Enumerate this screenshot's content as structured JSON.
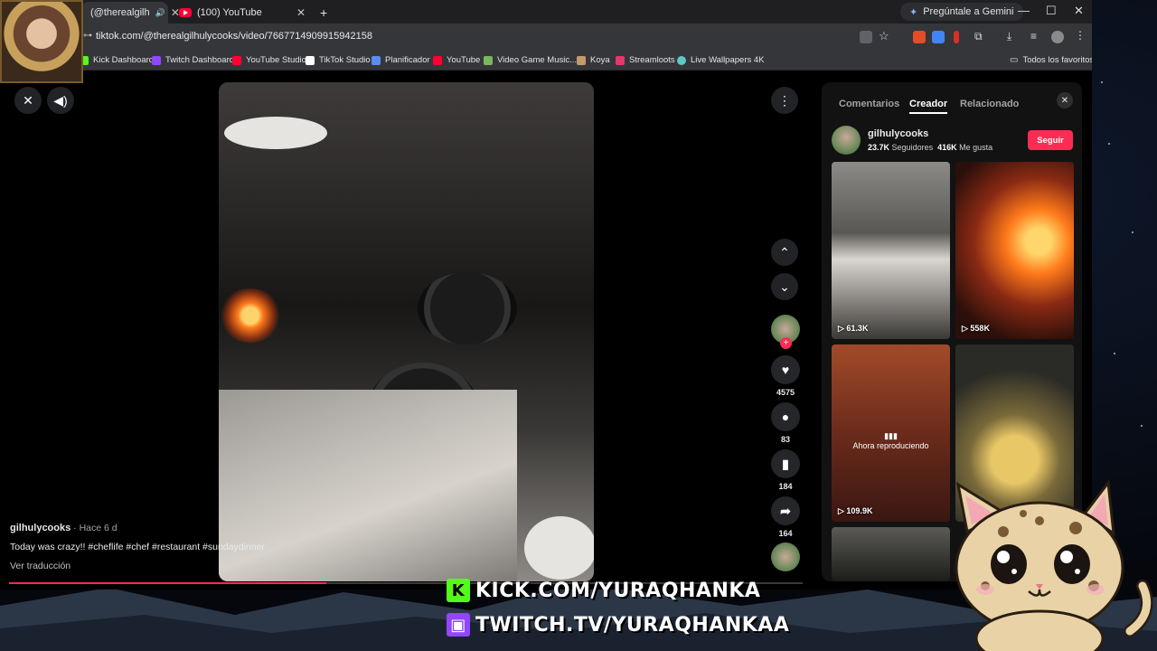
{
  "browser": {
    "tabs": [
      {
        "label": "(@therealgilh"
      },
      {
        "label": "(100) YouTube"
      }
    ],
    "new_tab": "+",
    "gemini": "Pregúntale a Gemini",
    "url": "tiktok.com/@therealgilhulycooks/video/7667714909915942158",
    "bookmarks": [
      {
        "label": "Kick Dashboard",
        "color": "#53fc18"
      },
      {
        "label": "Twitch Dashboard",
        "color": "#9146ff"
      },
      {
        "label": "YouTube Studio",
        "color": "#ff0033"
      },
      {
        "label": "TikTok Studio",
        "color": "#ffffff"
      },
      {
        "label": "Planificador",
        "color": "#5b8def"
      },
      {
        "label": "YouTube",
        "color": "#ff0033"
      },
      {
        "label": "Video Game Music...",
        "color": "#7bb661"
      },
      {
        "label": "Koya",
        "color": "#c49a6c"
      },
      {
        "label": "Streamloots",
        "color": "#e2386b"
      },
      {
        "label": "Live Wallpapers 4K",
        "color": "#5fc7c7"
      }
    ],
    "all_bookmarks": "Todos los favoritos"
  },
  "video": {
    "caption_user": "gilhulycooks",
    "caption_ago": " · Hace 6 d",
    "caption_text": "Today was crazy!! #cheflife #chef #restaurant #sundaydinner",
    "translate": "Ver traducción",
    "progress": 0.4,
    "likes": "4575",
    "comments": "83",
    "saves": "184",
    "shares": "164"
  },
  "panel": {
    "tabs": [
      "Comentarios",
      "Creador",
      "Relacionado"
    ],
    "creator_name": "gilhulycooks",
    "followers": "23.7K",
    "followers_label": "Seguidores",
    "likes": "416K",
    "likes_label": "Me gusta",
    "follow": "Seguir",
    "thumbs": [
      {
        "views": "61.3K"
      },
      {
        "views": "558K"
      },
      {
        "views": "109.9K",
        "status": "Ahora reproduciendo"
      },
      {
        "views": ""
      }
    ]
  },
  "overlay": {
    "kick": "KICK.COM/YURAQHANKA",
    "twitch": "TWITCH.TV/YURAQHANKAA"
  },
  "colors": {
    "accent": "#fe2c55",
    "kick": "#53fc18",
    "twitch": "#9146ff"
  },
  "icons": [
    "close-icon",
    "volume-icon",
    "more-icon",
    "chevron-up-icon",
    "chevron-down-icon",
    "heart-icon",
    "comment-icon",
    "bookmark-icon",
    "share-icon"
  ]
}
